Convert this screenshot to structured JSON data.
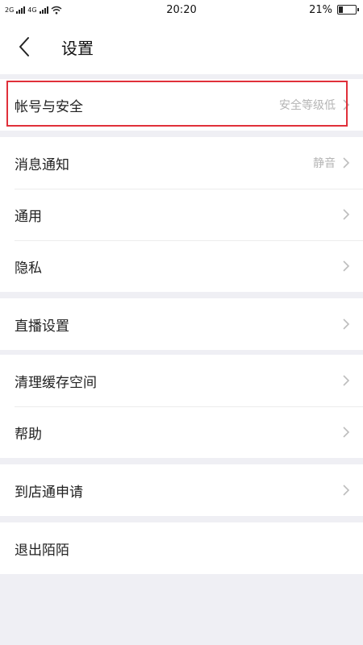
{
  "status_bar": {
    "network_left": "2G",
    "network_right": "4G",
    "time": "20:20",
    "battery": "21%"
  },
  "header": {
    "title": "设置"
  },
  "groups": [
    {
      "items": [
        {
          "label": "帐号与安全",
          "value": "安全等级低"
        }
      ]
    },
    {
      "items": [
        {
          "label": "消息通知",
          "value": "静音"
        },
        {
          "label": "通用"
        },
        {
          "label": "隐私"
        }
      ]
    },
    {
      "items": [
        {
          "label": "直播设置"
        }
      ]
    },
    {
      "items": [
        {
          "label": "清理缓存空间"
        },
        {
          "label": "帮助"
        }
      ]
    },
    {
      "items": [
        {
          "label": "到店通申请"
        }
      ]
    },
    {
      "items": [
        {
          "label": "退出陌陌"
        }
      ]
    }
  ],
  "colors": {
    "highlight": "#e0303a",
    "background": "#efeff4"
  },
  "icons": {
    "back": "chevron-left-icon",
    "item_arrow": "chevron-right-icon"
  }
}
